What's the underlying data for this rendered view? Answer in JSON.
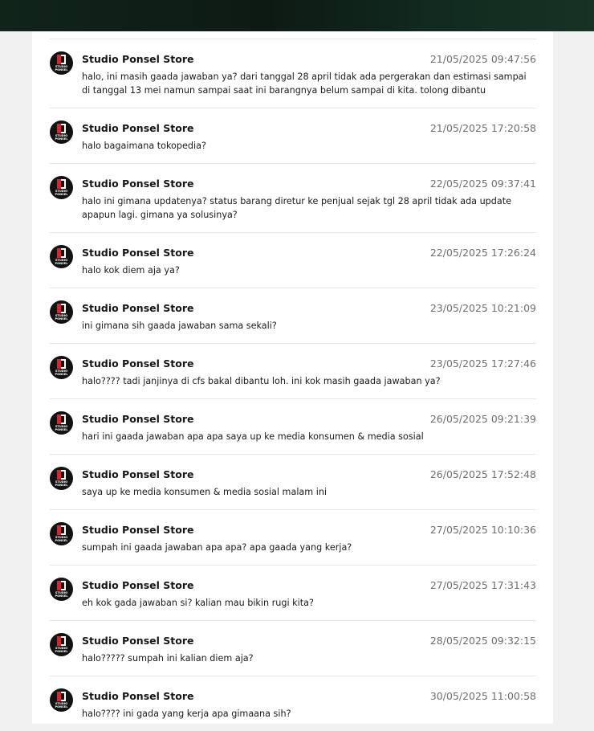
{
  "messages": [
    {
      "sender": "Studio Ponsel Store",
      "time": "21/05/2025 09:47:56",
      "text": "halo, ini masih gaada jawaban ya? dari tanggal 28 april tidak ada pergerakan dan estimasi sampai di tanggal 13 mei namun sampai saat ini barangnya belum sampai di kita. tolong dibantu"
    },
    {
      "sender": "Studio Ponsel Store",
      "time": "21/05/2025 17:20:58",
      "text": "halo bagaimana tokopedia?"
    },
    {
      "sender": "Studio Ponsel Store",
      "time": "22/05/2025 09:37:41",
      "text": "halo ini gimana updatenya? status barang diretur ke penjual sejak tgl 28 april tidak ada update apapun lagi. gimana ya solusinya?"
    },
    {
      "sender": "Studio Ponsel Store",
      "time": "22/05/2025 17:26:24",
      "text": "halo kok diem aja ya?"
    },
    {
      "sender": "Studio Ponsel Store",
      "time": "23/05/2025 10:21:09",
      "text": "ini gimana sih gaada jawaban sama sekali?"
    },
    {
      "sender": "Studio Ponsel Store",
      "time": "23/05/2025 17:27:46",
      "text": "halo???? tadi janjinya di cfs bakal dibantu loh. ini kok masih gaada jawaban ya?"
    },
    {
      "sender": "Studio Ponsel Store",
      "time": "26/05/2025 09:21:39",
      "text": "hari ini gaada jawaban apa apa saya up ke media konsumen & media sosial"
    },
    {
      "sender": "Studio Ponsel Store",
      "time": "26/05/2025 17:52:48",
      "text": "saya up ke media konsumen & media sosial malam ini"
    },
    {
      "sender": "Studio Ponsel Store",
      "time": "27/05/2025 10:10:36",
      "text": "sumpah ini gaada jawaban apa apa? apa gaada yang kerja?"
    },
    {
      "sender": "Studio Ponsel Store",
      "time": "27/05/2025 17:31:43",
      "text": "eh kok gada jawaban si? kalian mau bikin rugi kita?"
    },
    {
      "sender": "Studio Ponsel Store",
      "time": "28/05/2025 09:32:15",
      "text": "halo????? sumpah ini kalian diem aja?"
    },
    {
      "sender": "Studio Ponsel Store",
      "time": "30/05/2025 11:00:58",
      "text": "halo???? ini gada yang kerja apa gimaana sih?"
    }
  ],
  "avatar": {
    "icon": "studio-ponsel-logo-icon",
    "logo_text_line1": "STUDIO",
    "logo_text_line2": "PONSEL",
    "background_color": "#121212",
    "accent_color": "#d8262a"
  }
}
